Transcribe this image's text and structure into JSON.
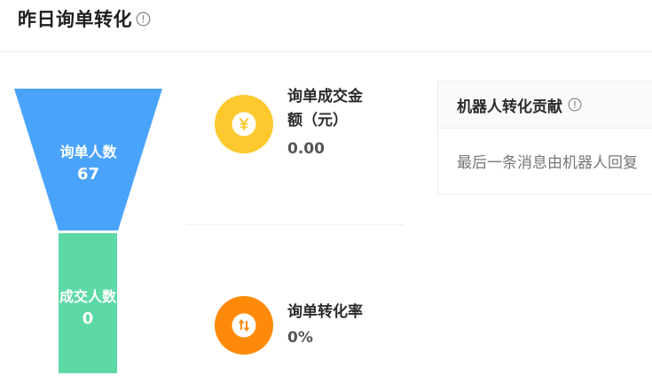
{
  "header": {
    "title": "昨日询单转化"
  },
  "funnel": {
    "inquiry": {
      "label": "询单人数",
      "value": "67",
      "color": "#4aa3fb"
    },
    "deal": {
      "label": "成交人数",
      "value": "0",
      "color": "#5dd9a6"
    }
  },
  "metrics": {
    "amount": {
      "label_line1": "询单成交金",
      "label_line2": "额（元）",
      "value": "0.00",
      "icon": "yen-icon",
      "color": "#fdc92f"
    },
    "conversion": {
      "label": "询单转化率",
      "value": "0%",
      "icon": "exchange-arrows-icon",
      "color": "#ff8a0a"
    }
  },
  "robot_card": {
    "title": "机器人转化贡献",
    "body": "最后一条消息由机器人回复"
  }
}
